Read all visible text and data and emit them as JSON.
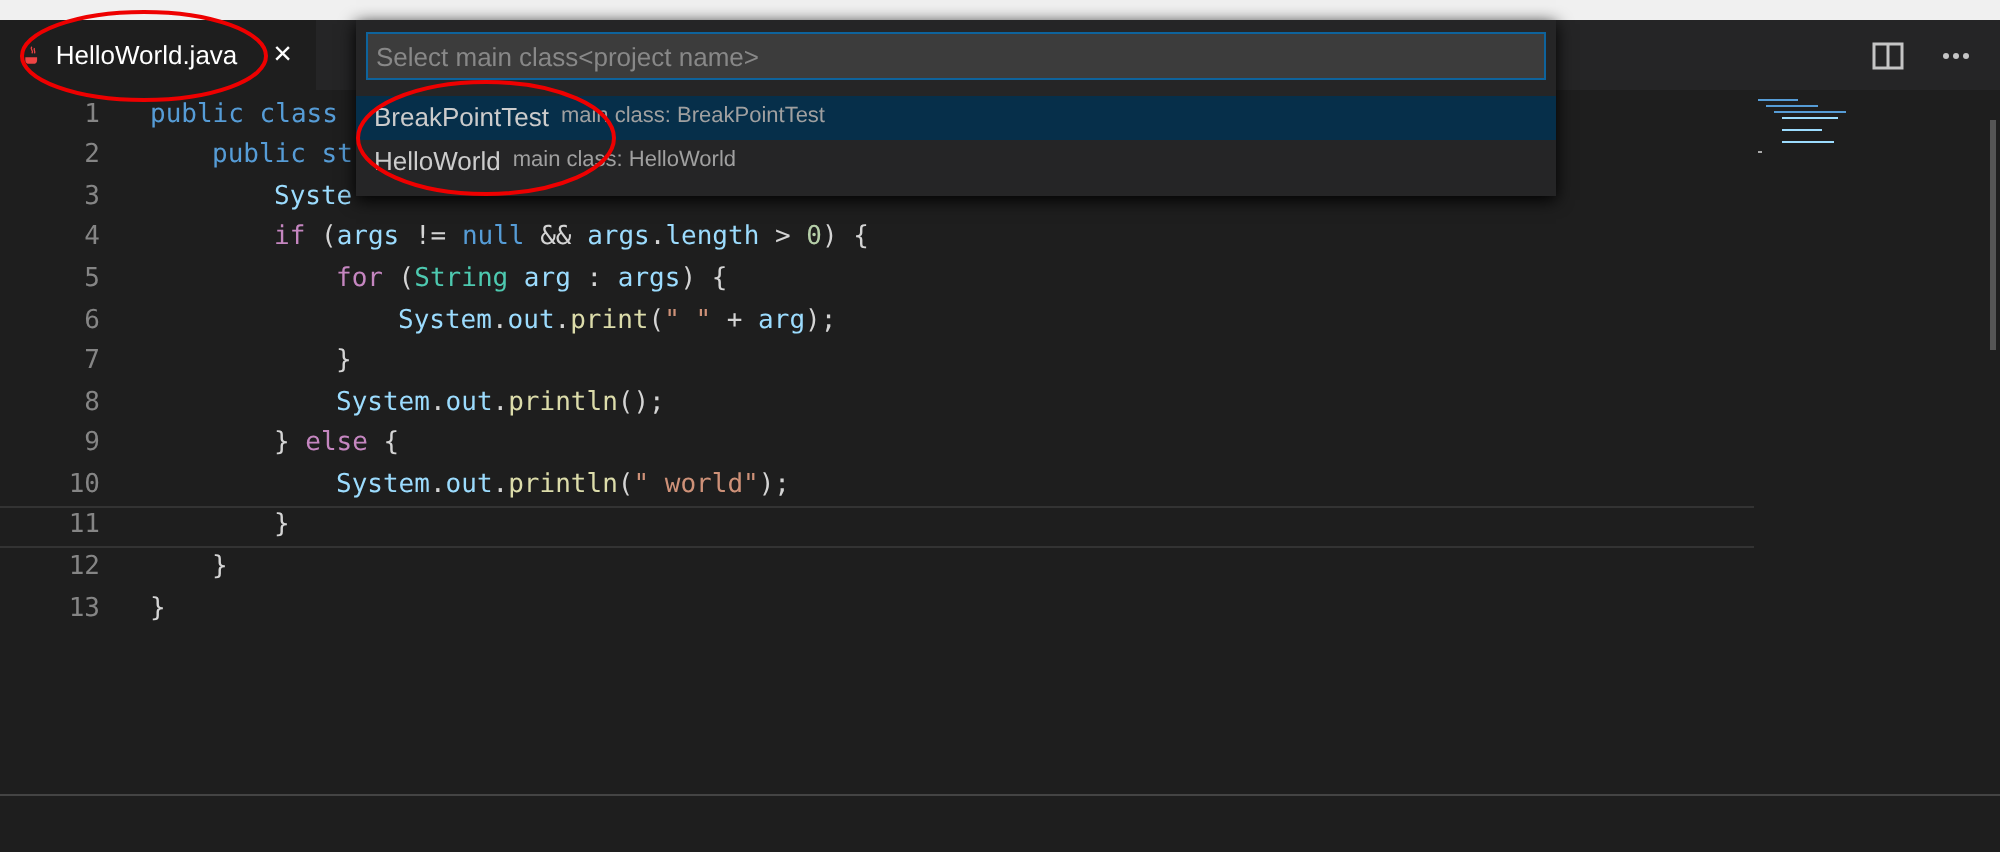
{
  "tabs": [
    {
      "label": "HelloWorld.java",
      "selected": true,
      "close": "×"
    }
  ],
  "quick_pick": {
    "placeholder": "Select main class<project name>",
    "items": [
      {
        "label": "BreakPointTest",
        "description": "main class: BreakPointTest",
        "selected": true
      },
      {
        "label": "HelloWorld",
        "description": "main class: HelloWorld",
        "selected": false
      }
    ]
  },
  "editor": {
    "lines": [
      {
        "number": "1",
        "current": false,
        "tokens": [
          {
            "kind": "keyword",
            "text": "public class"
          }
        ],
        "children": [
          {
            "number": "2",
            "current": false,
            "tokens": [
              {
                "kind": "keyword",
                "text": "public st"
              }
            ],
            "children": [
              {
                "number": "3",
                "current": false,
                "tokens": [
                  {
                    "kind": "ident",
                    "text": "Syste"
                  }
                ]
              },
              {
                "number": "4",
                "current": false,
                "tokens": [
                  {
                    "kind": "control",
                    "text": "if"
                  },
                  {
                    "kind": "plain",
                    "text": " ("
                  },
                  {
                    "kind": "ident",
                    "text": "args"
                  },
                  {
                    "kind": "plain",
                    "text": " != "
                  },
                  {
                    "kind": "keyword",
                    "text": "null"
                  },
                  {
                    "kind": "plain",
                    "text": " && "
                  },
                  {
                    "kind": "ident",
                    "text": "args"
                  },
                  {
                    "kind": "plain",
                    "text": "."
                  },
                  {
                    "kind": "ident",
                    "text": "length"
                  },
                  {
                    "kind": "plain",
                    "text": " > "
                  },
                  {
                    "kind": "number",
                    "text": "0"
                  },
                  {
                    "kind": "plain",
                    "text": ") {"
                  }
                ],
                "children": [
                  {
                    "number": "5",
                    "current": false,
                    "tokens": [
                      {
                        "kind": "control",
                        "text": "for"
                      },
                      {
                        "kind": "plain",
                        "text": " ("
                      },
                      {
                        "kind": "type",
                        "text": "String"
                      },
                      {
                        "kind": "ident",
                        "text": " arg"
                      },
                      {
                        "kind": "plain",
                        "text": " : "
                      },
                      {
                        "kind": "ident",
                        "text": "args"
                      },
                      {
                        "kind": "plain",
                        "text": ") {"
                      }
                    ],
                    "children": [
                      {
                        "number": "6",
                        "current": false,
                        "tokens": [
                          {
                            "kind": "ident",
                            "text": "System"
                          },
                          {
                            "kind": "plain",
                            "text": "."
                          },
                          {
                            "kind": "ident",
                            "text": "out"
                          },
                          {
                            "kind": "plain",
                            "text": "."
                          },
                          {
                            "kind": "func",
                            "text": "print"
                          },
                          {
                            "kind": "plain",
                            "text": "("
                          },
                          {
                            "kind": "string",
                            "text": "\" \""
                          },
                          {
                            "kind": "plain",
                            "text": " + "
                          },
                          {
                            "kind": "ident",
                            "text": "arg"
                          },
                          {
                            "kind": "plain",
                            "text": ");"
                          }
                        ]
                      }
                    ]
                  },
                  {
                    "number": "7",
                    "current": false,
                    "tokens": [
                      {
                        "kind": "plain",
                        "text": "}"
                      }
                    ]
                  },
                  {
                    "number": "8",
                    "current": false,
                    "tokens": [
                      {
                        "kind": "ident",
                        "text": "System"
                      },
                      {
                        "kind": "plain",
                        "text": "."
                      },
                      {
                        "kind": "ident",
                        "text": "out"
                      },
                      {
                        "kind": "plain",
                        "text": "."
                      },
                      {
                        "kind": "func",
                        "text": "println"
                      },
                      {
                        "kind": "plain",
                        "text": "();"
                      }
                    ]
                  }
                ]
              },
              {
                "number": "9",
                "current": false,
                "tokens": [
                  {
                    "kind": "plain",
                    "text": "} "
                  },
                  {
                    "kind": "control",
                    "text": "else"
                  },
                  {
                    "kind": "plain",
                    "text": " {"
                  }
                ],
                "children": [
                  {
                    "number": "10",
                    "current": false,
                    "tokens": [
                      {
                        "kind": "ident",
                        "text": "System"
                      },
                      {
                        "kind": "plain",
                        "text": "."
                      },
                      {
                        "kind": "ident",
                        "text": "out"
                      },
                      {
                        "kind": "plain",
                        "text": "."
                      },
                      {
                        "kind": "func",
                        "text": "println"
                      },
                      {
                        "kind": "plain",
                        "text": "("
                      },
                      {
                        "kind": "string",
                        "text": "\" world\""
                      },
                      {
                        "kind": "plain",
                        "text": ");"
                      }
                    ]
                  }
                ]
              },
              {
                "number": "11",
                "current": true,
                "tokens": [
                  {
                    "kind": "plain",
                    "text": "}"
                  }
                ]
              }
            ]
          },
          {
            "number": "12",
            "current": false,
            "tokens": [
              {
                "kind": "plain",
                "text": "}"
              }
            ]
          }
        ]
      },
      {
        "number": "13",
        "current": false,
        "tokens": [
          {
            "kind": "plain",
            "text": "}"
          }
        ]
      }
    ]
  }
}
